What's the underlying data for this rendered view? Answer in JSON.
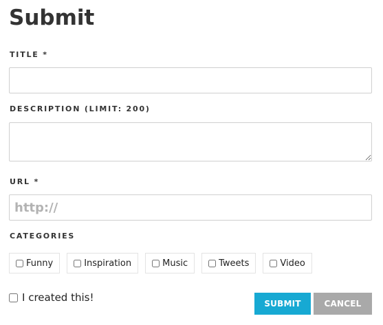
{
  "page": {
    "title": "Submit"
  },
  "fields": {
    "title": {
      "label": "TITLE *",
      "value": "",
      "placeholder": ""
    },
    "description": {
      "label": "DESCRIPTION (LIMIT: 200)",
      "value": "",
      "placeholder": ""
    },
    "url": {
      "label": "URL *",
      "value": "",
      "placeholder": "http://"
    }
  },
  "categories": {
    "label": "CATEGORIES",
    "items": [
      {
        "label": "Funny",
        "checked": false
      },
      {
        "label": "Inspiration",
        "checked": false
      },
      {
        "label": "Music",
        "checked": false
      },
      {
        "label": "Tweets",
        "checked": false
      },
      {
        "label": "Video",
        "checked": false
      }
    ]
  },
  "created": {
    "label": "I created this!",
    "checked": false
  },
  "actions": {
    "submit_label": "SUBMIT",
    "cancel_label": "CANCEL"
  },
  "colors": {
    "submit_bg": "#17a9d3",
    "cancel_bg": "#a9a9a9",
    "text": "#333333"
  }
}
